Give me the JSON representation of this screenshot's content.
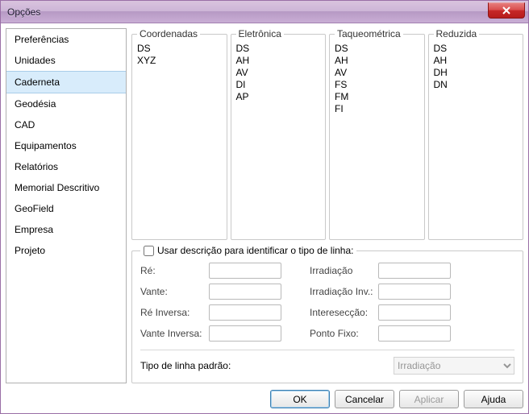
{
  "window": {
    "title": "Opções"
  },
  "sidebar": {
    "items": [
      {
        "label": "Preferências",
        "selected": false
      },
      {
        "label": "Unidades",
        "selected": false
      },
      {
        "label": "Caderneta",
        "selected": true
      },
      {
        "label": "Geodésia",
        "selected": false
      },
      {
        "label": "CAD",
        "selected": false
      },
      {
        "label": "Equipamentos",
        "selected": false
      },
      {
        "label": "Relatórios",
        "selected": false
      },
      {
        "label": "Memorial Descritivo",
        "selected": false
      },
      {
        "label": "GeoField",
        "selected": false
      },
      {
        "label": "Empresa",
        "selected": false
      },
      {
        "label": "Projeto",
        "selected": false
      }
    ]
  },
  "columns": [
    {
      "title": "Coordenadas",
      "items": [
        "DS",
        "XYZ"
      ]
    },
    {
      "title": "Eletrônica",
      "items": [
        "DS",
        "AH",
        "AV",
        "DI",
        "AP"
      ]
    },
    {
      "title": "Taqueométrica",
      "items": [
        "DS",
        "AH",
        "AV",
        "FS",
        "FM",
        "FI"
      ]
    },
    {
      "title": "Reduzida",
      "items": [
        "DS",
        "AH",
        "DH",
        "DN"
      ]
    }
  ],
  "desc": {
    "checkbox_label": "Usar descrição para identificar o tipo de linha:",
    "checked": false,
    "fields_left": [
      "Ré:",
      "Vante:",
      "Ré Inversa:",
      "Vante Inversa:"
    ],
    "fields_right": [
      "Irradiação",
      "Irradiação Inv.:",
      "Interesecção:",
      "Ponto Fixo:"
    ],
    "default_label": "Tipo de linha padrão:",
    "default_value": "Irradiação"
  },
  "buttons": {
    "ok": "OK",
    "cancel": "Cancelar",
    "apply": "Aplicar",
    "help": "Ajuda"
  }
}
